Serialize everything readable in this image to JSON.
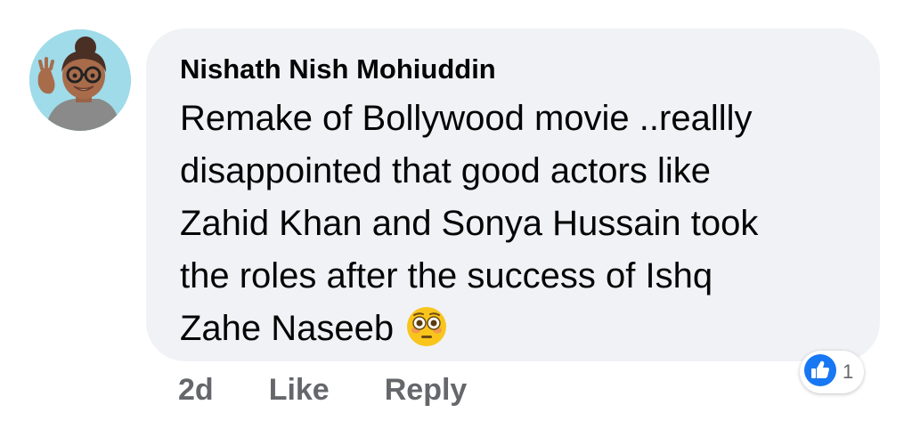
{
  "comment": {
    "author": "Nishath Nish Mohiuddin",
    "lines": [
      "Remake of Bollywood movie ..reallly",
      "disappointed that good actors like",
      "Zahid Khan and Sonya Hussain took",
      "the roles after the success of Ishq",
      "Zahe Naseeb"
    ],
    "emoji": "flushed-face-icon",
    "time": "2d",
    "like_label": "Like",
    "reply_label": "Reply",
    "reaction_icon": "thumbs-up-icon",
    "reaction_count": "1"
  },
  "colors": {
    "bubble": "#f0f2f5",
    "accent": "#1877f2",
    "secondary_text": "#65676b"
  }
}
